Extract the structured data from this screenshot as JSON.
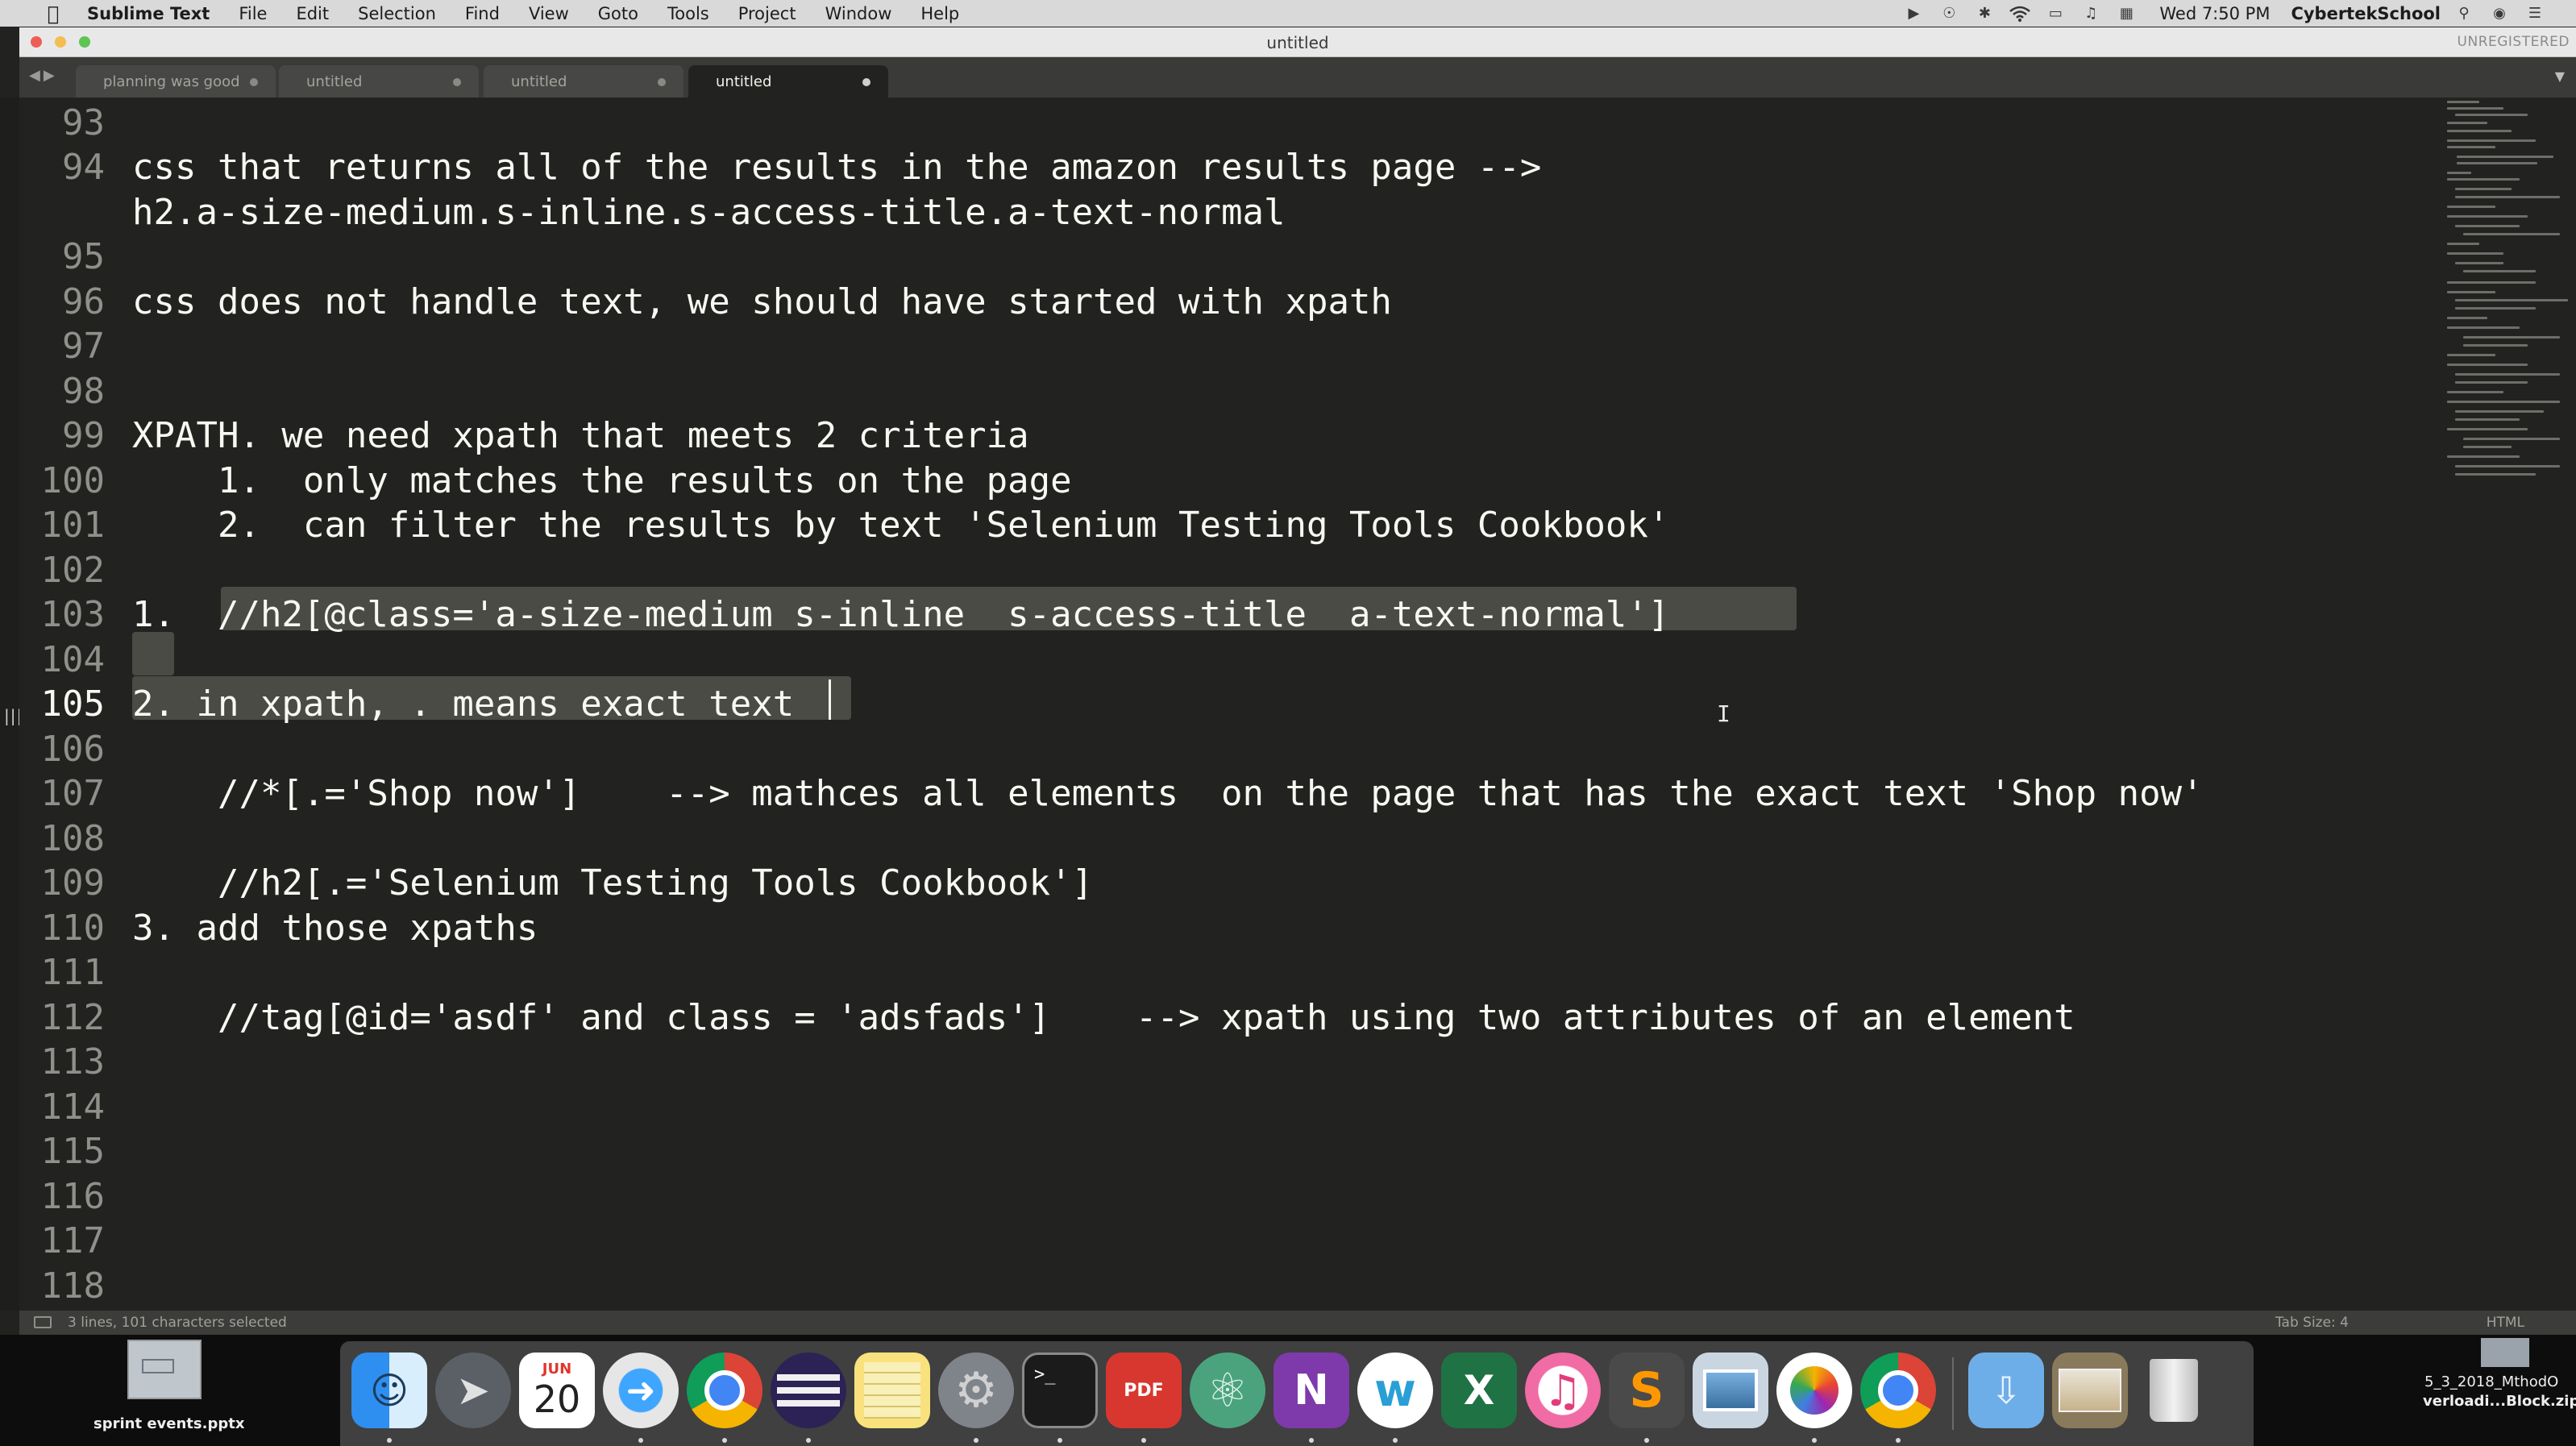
{
  "menubar": {
    "app_name": "Sublime Text",
    "items": [
      "File",
      "Edit",
      "Selection",
      "Find",
      "View",
      "Goto",
      "Tools",
      "Project",
      "Window",
      "Help"
    ],
    "clock": "Wed 7:50 PM",
    "user": "CybertekSchool"
  },
  "window": {
    "title": "untitled",
    "registration": "UNREGISTERED"
  },
  "tabs": [
    {
      "label": "planning was good",
      "active": false
    },
    {
      "label": "untitled",
      "active": false
    },
    {
      "label": "untitled",
      "active": false
    },
    {
      "label": "untitled",
      "active": true
    }
  ],
  "editor": {
    "lines": [
      {
        "num": "93",
        "text": ""
      },
      {
        "num": "94",
        "text": "css that returns all of the results in the amazon results page -->"
      },
      {
        "num": "",
        "text": "h2.a-size-medium.s-inline.s-access-title.a-text-normal"
      },
      {
        "num": "95",
        "text": ""
      },
      {
        "num": "96",
        "text": "css does not handle text, we should have started with xpath"
      },
      {
        "num": "97",
        "text": ""
      },
      {
        "num": "98",
        "text": ""
      },
      {
        "num": "99",
        "text": "XPATH. we need xpath that meets 2 criteria"
      },
      {
        "num": "100",
        "text": "    1.  only matches the results on the page"
      },
      {
        "num": "101",
        "text": "    2.  can filter the results by text 'Selenium Testing Tools Cookbook'"
      },
      {
        "num": "102",
        "text": ""
      },
      {
        "num": "103",
        "text": "1.  //h2[@class='a-size-medium s-inline  s-access-title  a-text-normal']"
      },
      {
        "num": "104",
        "text": ""
      },
      {
        "num": "105",
        "text": "2. in xpath, . means exact text"
      },
      {
        "num": "106",
        "text": ""
      },
      {
        "num": "107",
        "text": "    //*[.='Shop now']    --> mathces all elements  on the page that has the exact text 'Shop now'"
      },
      {
        "num": "108",
        "text": ""
      },
      {
        "num": "109",
        "text": "    //h2[.='Selenium Testing Tools Cookbook']"
      },
      {
        "num": "110",
        "text": "3. add those xpaths"
      },
      {
        "num": "111",
        "text": ""
      },
      {
        "num": "112",
        "text": "    //tag[@id='asdf' and class = 'adsfads']    --> xpath using two attributes of an element"
      },
      {
        "num": "113",
        "text": ""
      },
      {
        "num": "114",
        "text": ""
      },
      {
        "num": "115",
        "text": ""
      },
      {
        "num": "116",
        "text": ""
      },
      {
        "num": "117",
        "text": ""
      },
      {
        "num": "118",
        "text": ""
      }
    ]
  },
  "statusbar": {
    "selection": "3 lines, 101 characters selected",
    "tab_size": "Tab Size: 4",
    "syntax": "HTML"
  },
  "desktop": {
    "left_file": "sprint events.pptx",
    "right_file_line1": "5_3_2018_MthodO",
    "right_file_line2": "verloadi...Block.zip"
  },
  "dock": {
    "calendar_month": "JUN",
    "calendar_day": "20",
    "pdf_label": "PDF"
  },
  "colors": {
    "editor_bg": "#222320",
    "text": "#f8f8f2",
    "line_numbers": "#8f908a",
    "selection": "#4a4b45"
  }
}
